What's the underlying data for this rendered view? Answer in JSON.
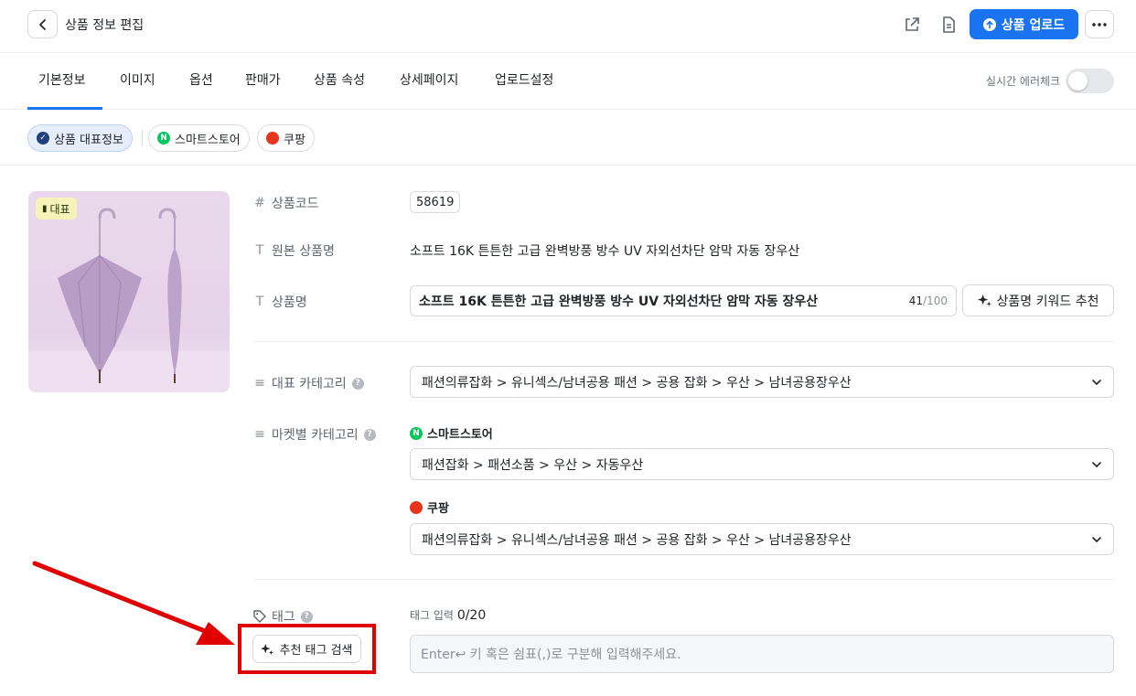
{
  "header": {
    "title": "상품 정보 편집",
    "upload_label": "상품 업로드"
  },
  "tabs": [
    {
      "label": "기본정보",
      "active": true
    },
    {
      "label": "이미지"
    },
    {
      "label": "옵션"
    },
    {
      "label": "판매가"
    },
    {
      "label": "상품 속성"
    },
    {
      "label": "상세페이지"
    },
    {
      "label": "업로드설정"
    }
  ],
  "error_check": {
    "label": "실시간 에러체크",
    "enabled": false
  },
  "chips": [
    {
      "label": "상품 대표정보",
      "active": true
    },
    {
      "label": "스마트스토어"
    },
    {
      "label": "쿠팡"
    }
  ],
  "image_badge": "대표",
  "form": {
    "code_label": "상품코드",
    "code_value": "58619",
    "orig_name_label": "원본 상품명",
    "orig_name_value": "소프트 16K 튼튼한 고급 완벽방풍 방수 UV 자외선차단 암막 자동 장우산",
    "name_label": "상품명",
    "name_value": "소프트 16K 튼튼한 고급 완벽방풍 방수 UV 자외선차단 암막 자동 장우산",
    "name_count": "41",
    "name_max": "/100",
    "keyword_btn": "상품명 키워드 추천",
    "rep_category_label": "대표 카테고리",
    "rep_category_value": "패션의류잡화 > 유니섹스/남녀공용 패션 > 공용 잡화 > 우산 > 남녀공용장우산",
    "market_category_label": "마켓별 카테고리",
    "smartstore_label": "스마트스토어",
    "smartstore_value": "패션잡화 > 패션소품 > 우산 > 자동우산",
    "coupang_label": "쿠팡",
    "coupang_value": "패션의류잡화 > 유니섹스/남녀공용 패션 > 공용 잡화 > 우산 > 남녀공용장우산",
    "tag_label": "태그",
    "tag_input_label": "태그 입력",
    "tag_count": "0/20",
    "tag_placeholder": "Enter↩ 키 혹은 쉼표(,)로 구분해 입력해주세요.",
    "tag_search_btn": "추천 태그 검색"
  },
  "colors": {
    "accent": "#1a73f0",
    "annotation_red": "#e00000",
    "naver_green": "#03c75a",
    "coupang_red": "#e8341c"
  }
}
